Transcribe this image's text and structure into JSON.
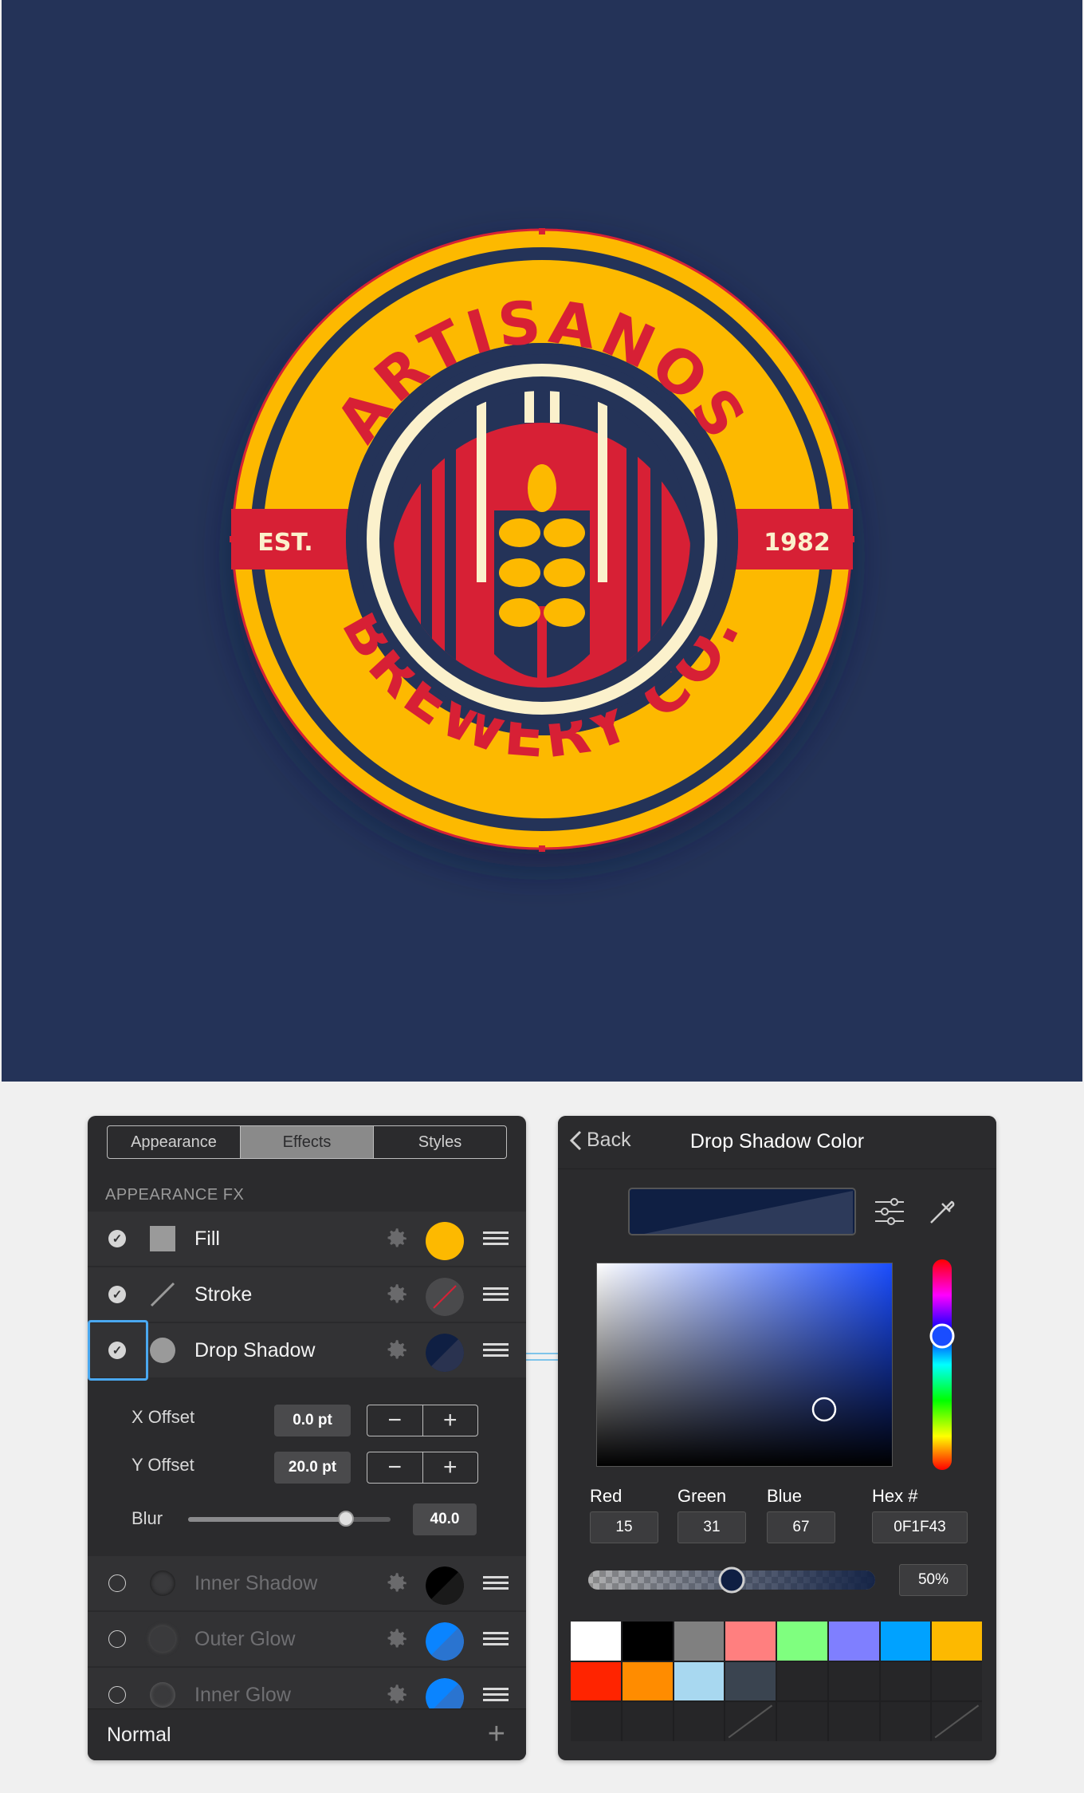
{
  "artboard": {
    "background": "#243358",
    "logo": {
      "top_text": "ARTISANOS",
      "bottom_text": "BREWERY CO.",
      "left_ribbon": "EST.",
      "right_ribbon": "1982",
      "colors": {
        "yellow": "#FDB900",
        "navy": "#243358",
        "red": "#D72035",
        "cream": "#FBF1CC"
      }
    }
  },
  "left_panel": {
    "tabs": [
      "Appearance",
      "Effects",
      "Styles"
    ],
    "active_tab": "Effects",
    "section_label": "APPEARANCE FX",
    "effects": [
      {
        "label": "Fill",
        "enabled": true,
        "icon": "square-fill-icon",
        "swatch": "#FDB900"
      },
      {
        "label": "Stroke",
        "enabled": true,
        "icon": "stroke-line-icon",
        "swatch": "none"
      },
      {
        "label": "Drop Shadow",
        "enabled": true,
        "icon": "shadow-circle-icon",
        "swatch": "#0F1F43"
      }
    ],
    "shadow_settings": {
      "x_offset_label": "X Offset",
      "x_offset_value": "0.0 pt",
      "y_offset_label": "Y Offset",
      "y_offset_value": "20.0 pt",
      "blur_label": "Blur",
      "blur_value": "40.0",
      "blur_fraction": 0.78
    },
    "disabled_effects": [
      {
        "label": "Inner Shadow",
        "enabled": false,
        "swatch": "#000000"
      },
      {
        "label": "Outer Glow",
        "enabled": false,
        "swatch": "#0A84FF"
      },
      {
        "label": "Inner Glow",
        "enabled": false,
        "swatch": "#0A84FF"
      }
    ],
    "blend_mode": "Normal"
  },
  "right_panel": {
    "back_label": "Back",
    "title": "Drop Shadow Color",
    "current_color": "#0F1F43",
    "channels": {
      "red_label": "Red",
      "red": "15",
      "green_label": "Green",
      "green": "31",
      "blue_label": "Blue",
      "blue": "67",
      "hex_label": "Hex #",
      "hex": "0F1F43"
    },
    "opacity": "50%",
    "opacity_fraction": 0.5,
    "swatches": [
      "#FFFFFF",
      "#000000",
      "#808080",
      "#FF7F7F",
      "#7FFF7F",
      "#7F7FFF",
      "#00A2FF",
      "#FDB900",
      "#FF2400",
      "#FF8C00",
      "#A8D8F0",
      "#3A4450"
    ]
  }
}
